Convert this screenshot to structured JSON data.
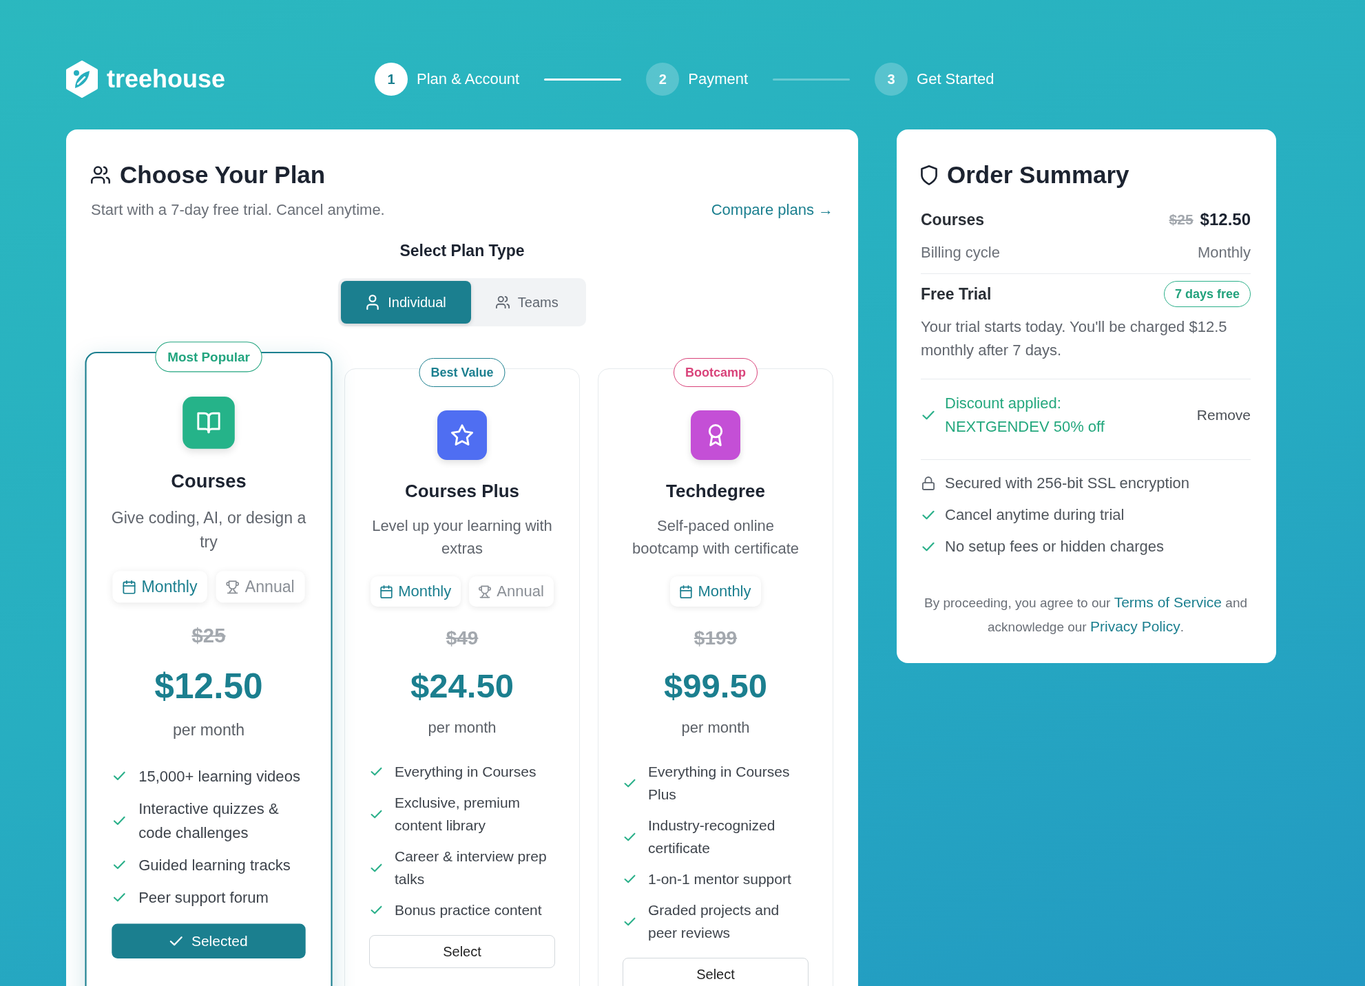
{
  "brand": {
    "name": "treehouse"
  },
  "steps": [
    {
      "number": "1",
      "label": "Plan & Account",
      "active": true
    },
    {
      "number": "2",
      "label": "Payment",
      "active": false
    },
    {
      "number": "3",
      "label": "Get Started",
      "active": false
    }
  ],
  "plan_panel": {
    "title": "Choose Your Plan",
    "subtitle": "Start with a 7-day free trial. Cancel anytime.",
    "compare_link": "Compare plans →",
    "plan_type_label": "Select Plan Type",
    "plan_types": [
      {
        "label": "Individual",
        "selected": true
      },
      {
        "label": "Teams",
        "selected": false
      }
    ],
    "plans": [
      {
        "badge": {
          "text": "Most Popular",
          "color": "#22a57f"
        },
        "color": "#25b389",
        "name": "Courses",
        "description": "Give coding, AI, or design a try",
        "billing_options": [
          {
            "label": "Monthly",
            "selected": true
          },
          {
            "label": "Annual",
            "selected": false
          }
        ],
        "original_price": "$25",
        "price": "$12.50",
        "period": "per month",
        "features": [
          "15,000+ learning videos",
          "Interactive quizzes & code challenges",
          "Guided learning tracks",
          "Peer support forum"
        ],
        "button": "Selected",
        "selected": true
      },
      {
        "badge": {
          "text": "Best Value",
          "color": "#1b7f8f"
        },
        "color": "#4f6ef2",
        "name": "Courses Plus",
        "description": "Level up your learning with extras",
        "billing_options": [
          {
            "label": "Monthly",
            "selected": true
          },
          {
            "label": "Annual",
            "selected": false
          }
        ],
        "original_price": "$49",
        "price": "$24.50",
        "period": "per month",
        "features": [
          "Everything in Courses",
          "Exclusive, premium content library",
          "Career & interview prep talks",
          "Bonus practice content"
        ],
        "button": "Select",
        "selected": false
      },
      {
        "badge": {
          "text": "Bootcamp",
          "color": "#d9437a"
        },
        "color": "#c44fd6",
        "name": "Techdegree",
        "description": "Self-paced online bootcamp with certificate",
        "billing_options": [
          {
            "label": "Monthly",
            "selected": true
          }
        ],
        "original_price": "$199",
        "price": "$99.50",
        "period": "per month",
        "features": [
          "Everything in Courses Plus",
          "Industry-recognized certificate",
          "1-on-1 mentor support",
          "Graded projects and peer reviews"
        ],
        "button": "Select",
        "selected": false
      }
    ]
  },
  "order_summary": {
    "title": "Order Summary",
    "plan": {
      "name": "Courses",
      "original_price": "$25",
      "price": "$12.50"
    },
    "billing": {
      "label": "Billing cycle",
      "value": "Monthly"
    },
    "trial": {
      "title": "Free Trial",
      "badge": "7 days free",
      "text": "Your trial starts today. You'll be charged $12.5 monthly after 7 days."
    },
    "discount": {
      "label": "Discount applied:",
      "code": "NEXTGENDEV 50% off",
      "action": "Remove"
    },
    "assurances": [
      {
        "kind": "security",
        "text": "Secured with 256-bit SSL encryption"
      },
      {
        "kind": "benefit",
        "text": "Cancel anytime during trial"
      },
      {
        "kind": "benefit",
        "text": "No setup fees or hidden charges"
      }
    ],
    "legal": {
      "before": "By proceeding, you agree to our",
      "terms_link": "Terms of Service",
      "middle": "and acknowledge our",
      "privacy_link": "Privacy Policy",
      "after": "."
    }
  }
}
